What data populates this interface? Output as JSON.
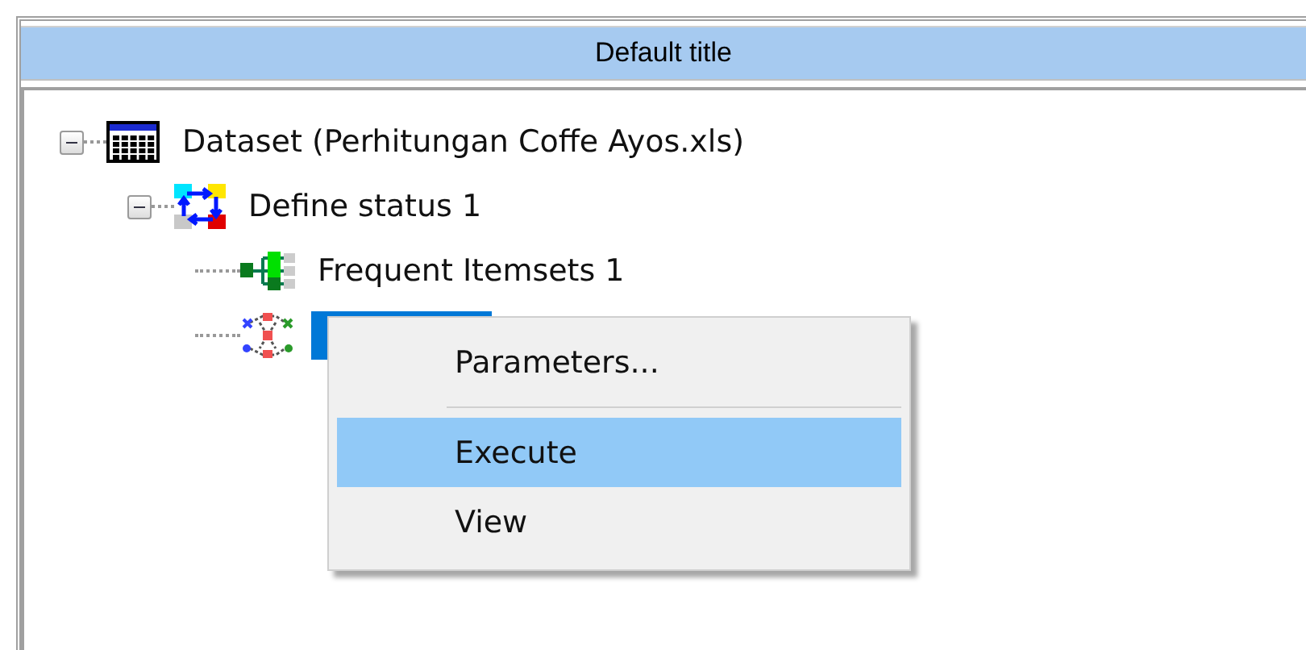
{
  "panel": {
    "title": "Default title"
  },
  "tree": [
    {
      "label": "Dataset (Perhitungan Coffe Ayos.xls)",
      "kind": "dataset",
      "expanded": true,
      "selected": false,
      "children": [
        {
          "label": "Define status 1",
          "kind": "status",
          "expanded": true,
          "selected": false,
          "children": [
            {
              "label": "Frequent Itemsets 1",
              "kind": "itemsets",
              "selected": false
            },
            {
              "kind": "rules",
              "selected": true
            }
          ]
        }
      ]
    }
  ],
  "context_menu": [
    {
      "label": "Parameters...",
      "selected": false
    },
    {
      "kind": "separator"
    },
    {
      "label": "Execute",
      "selected": true
    },
    {
      "label": "View",
      "selected": false
    }
  ]
}
